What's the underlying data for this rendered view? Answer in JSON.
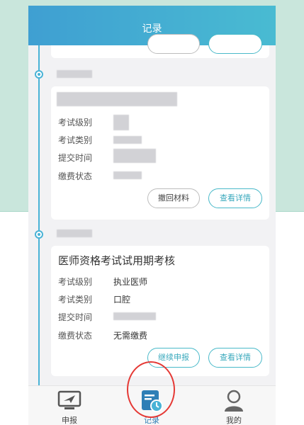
{
  "header": {
    "title": "记录"
  },
  "records": [
    {
      "labels": [
        "考试级别",
        "考试类别",
        "提交时间",
        "缴费状态"
      ],
      "buttons": {
        "withdraw": "撤回材料",
        "details": "查看详情"
      }
    },
    {
      "title": "医师资格考试试用期考核",
      "labels": [
        "考试级别",
        "考试类别",
        "提交时间",
        "缴费状态"
      ],
      "values": {
        "level": "执业医师",
        "category": "口腔",
        "fee_status": "无需缴费"
      },
      "buttons": {
        "continue": "继续申报",
        "details": "查看详情"
      }
    }
  ],
  "tabbar": {
    "tabs": [
      "申报",
      "记录",
      "我的"
    ]
  },
  "colors": {
    "accent": "#49b3d6",
    "annotation": "#e53935"
  }
}
